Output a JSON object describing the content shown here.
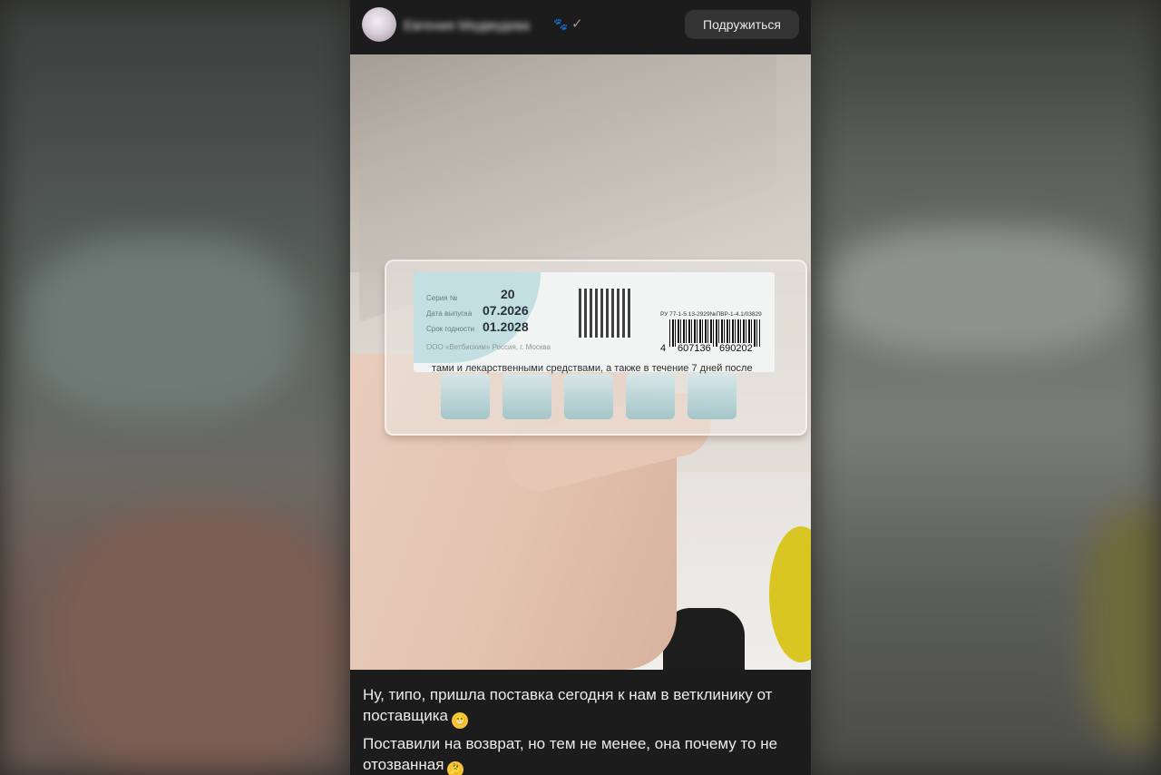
{
  "post": {
    "author_name": "Евгения Медведева",
    "friend_button_label": "Подружиться",
    "paw_icon": "🐾",
    "verified_icon": "✓",
    "caption_line1": "Ну, типо, пришла поставка сегодня к нам в ветклинику от поставщика",
    "caption_line2": "Поставили на возврат, но тем не менее, она почему то не отозванная",
    "emoji1": "😁",
    "emoji2": "🤔"
  },
  "photo_label": {
    "series_field": "Серия №",
    "series_value": "20",
    "manufactured_field": "Дата выпуска",
    "manufactured_value": "07.2026",
    "expiry_field": "Срок годности",
    "expiry_value": "01.2028",
    "company": "ООО «Ветбиохим» Россия, г. Москва",
    "registration": "РУ 77-1-5.13-2929№ПВР-1-4.1/03829",
    "barcode_digit": "4",
    "barcode_group1": "607136",
    "barcode_group2": "690202",
    "leaflet_text": "тами и лекарственными средствами, а также в течение 7 дней после"
  },
  "colors": {
    "background": "#1c1c1c",
    "button_bg": "#333333",
    "text": "#ececec"
  }
}
